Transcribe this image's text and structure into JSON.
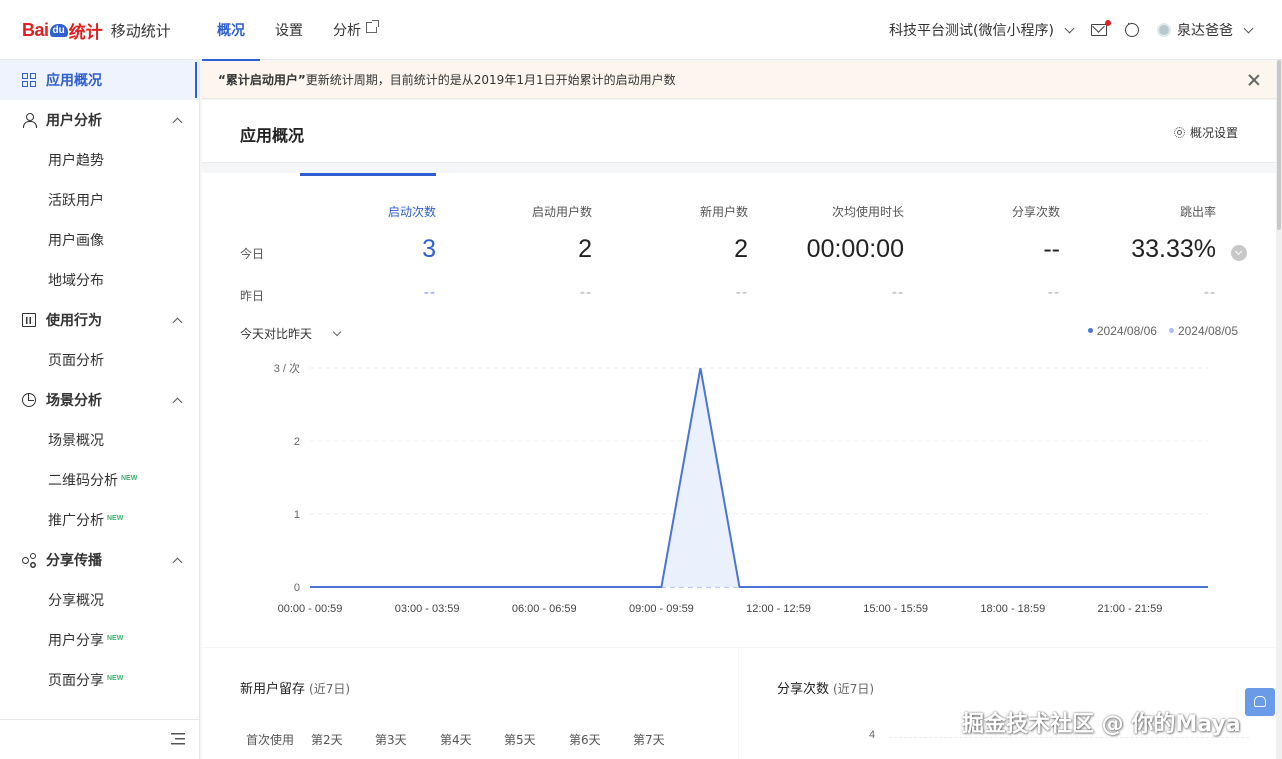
{
  "header": {
    "logo": {
      "bai": "Bai",
      "du": "du",
      "tongji": "统计",
      "sub": "移动统计"
    },
    "tabs": [
      {
        "label": "概况",
        "active": true
      },
      {
        "label": "设置",
        "active": false
      },
      {
        "label": "分析",
        "active": false,
        "external": true
      }
    ],
    "app_selector": "科技平台测试(微信小程序)",
    "user_name": "泉达爸爸"
  },
  "sidebar": {
    "items": [
      {
        "label": "应用概况",
        "type": "top",
        "icon": "grid-icon",
        "active": true
      },
      {
        "label": "用户分析",
        "type": "group",
        "icon": "user-icon"
      },
      {
        "label": "用户趋势",
        "type": "sub"
      },
      {
        "label": "活跃用户",
        "type": "sub"
      },
      {
        "label": "用户画像",
        "type": "sub"
      },
      {
        "label": "地域分布",
        "type": "sub"
      },
      {
        "label": "使用行为",
        "type": "group",
        "icon": "bar-chart-icon"
      },
      {
        "label": "页面分析",
        "type": "sub"
      },
      {
        "label": "场景分析",
        "type": "group",
        "icon": "pie-chart-icon"
      },
      {
        "label": "场景概况",
        "type": "sub"
      },
      {
        "label": "二维码分析",
        "type": "sub",
        "badge": "NEW"
      },
      {
        "label": "推广分析",
        "type": "sub",
        "badge": "NEW"
      },
      {
        "label": "分享传播",
        "type": "group",
        "icon": "share-icon"
      },
      {
        "label": "分享概况",
        "type": "sub"
      },
      {
        "label": "用户分享",
        "type": "sub",
        "badge": "NEW"
      },
      {
        "label": "页面分享",
        "type": "sub",
        "badge": "NEW"
      }
    ]
  },
  "notice": {
    "highlight": "“累计启动用户”",
    "text": "更新统计周期，目前统计的是从2019年1月1日开始累计的启动用户数"
  },
  "page": {
    "title": "应用概况",
    "settings_label": "概况设置"
  },
  "metrics": {
    "row_today": "今日",
    "row_yesterday": "昨日",
    "items": [
      {
        "label": "启动次数",
        "today": "3",
        "yesterday": "--",
        "active": true
      },
      {
        "label": "启动用户数",
        "today": "2",
        "yesterday": "--"
      },
      {
        "label": "新用户数",
        "today": "2",
        "yesterday": "--"
      },
      {
        "label": "次均使用时长",
        "today": "00:00:00",
        "yesterday": "--"
      },
      {
        "label": "分享次数",
        "today": "--",
        "yesterday": "--"
      },
      {
        "label": "跳出率",
        "today": "33.33%",
        "yesterday": "--"
      }
    ]
  },
  "compare": {
    "selected": "今天对比昨天"
  },
  "colors": {
    "primary": "#2f5fd0",
    "series_today": "#4a74d8",
    "series_yesterday": "#a9bff0",
    "notice_bg": "#fdf6ee"
  },
  "chart_data": {
    "type": "area",
    "ylabel": "3 / 次",
    "y_ticks": [
      "3 / 次",
      "2",
      "1",
      "0"
    ],
    "ylim": [
      0,
      3
    ],
    "x_tick_labels": [
      "00:00 - 00:59",
      "03:00 - 03:59",
      "06:00 - 06:59",
      "09:00 - 09:59",
      "12:00 - 12:59",
      "15:00 - 15:59",
      "18:00 - 18:59",
      "21:00 - 21:59"
    ],
    "x": [
      "00:00 - 00:59",
      "01:00 - 01:59",
      "02:00 - 02:59",
      "03:00 - 03:59",
      "04:00 - 04:59",
      "05:00 - 05:59",
      "06:00 - 06:59",
      "07:00 - 07:59",
      "08:00 - 08:59",
      "09:00 - 09:59",
      "10:00 - 10:59",
      "11:00 - 11:59",
      "12:00 - 12:59",
      "13:00 - 13:59",
      "14:00 - 14:59",
      "15:00 - 15:59",
      "16:00 - 16:59",
      "17:00 - 17:59",
      "18:00 - 18:59",
      "19:00 - 19:59",
      "20:00 - 20:59",
      "21:00 - 21:59",
      "22:00 - 22:59",
      "23:00 - 23:59"
    ],
    "series": [
      {
        "name": "2024/08/06",
        "values": [
          0,
          0,
          0,
          0,
          0,
          0,
          0,
          0,
          0,
          0,
          3,
          0,
          0,
          0,
          0,
          0,
          0,
          0,
          0,
          0,
          0,
          0,
          0,
          0
        ]
      },
      {
        "name": "2024/08/05",
        "values": [
          0,
          0,
          0,
          0,
          0,
          0,
          0,
          0,
          0,
          0,
          0,
          0,
          0,
          0,
          0,
          0,
          0,
          0,
          0,
          0,
          0,
          0,
          0,
          0
        ]
      }
    ],
    "grid": true,
    "legend": "top-right"
  },
  "retention": {
    "title": "新用户留存",
    "hint": "(近7日)",
    "headers": [
      "首次使用",
      "第2天",
      "第3天",
      "第4天",
      "第5天",
      "第6天",
      "第7天"
    ]
  },
  "share_card": {
    "title": "分享次数",
    "hint": "(近7日)",
    "y_tick": "4"
  },
  "watermark": "掘金技术社区 @ 你的Maya"
}
